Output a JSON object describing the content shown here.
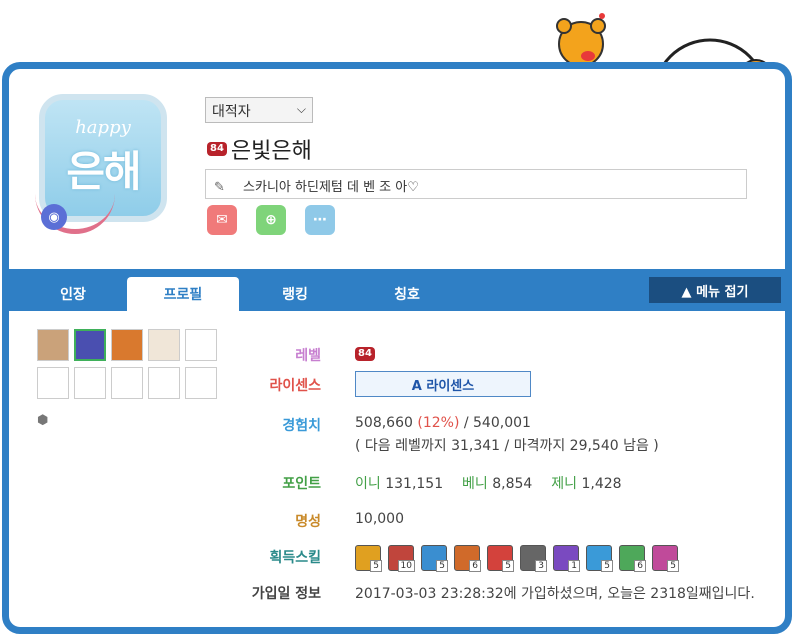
{
  "profile": {
    "job_select": "대적자",
    "level_badge": "84",
    "nickname": "은빛은해",
    "status_message": "스카니아 하딘제텀 데 벤 조 아♡",
    "avatar_text_top": "happy",
    "avatar_text_main": "은해"
  },
  "tabs": [
    {
      "label": "인장"
    },
    {
      "label": "프로필"
    },
    {
      "label": "랭킹"
    },
    {
      "label": "칭호"
    }
  ],
  "menu_fold_label": "▲ 메뉴 접기",
  "info": {
    "level_label": "레벨",
    "level_value": "84",
    "license_label": "라이센스",
    "license_button": "A  라이센스",
    "exp_label": "경험치",
    "exp_current": "508,660",
    "exp_percent": "(12%)",
    "exp_total": "/ 540,001",
    "exp_detail": "( 다음 레벨까지 31,341 / 마격까지 29,540 남음 )",
    "point_label": "포인트",
    "ini_label": "이니",
    "ini_value": "131,151",
    "beni_label": "베니",
    "beni_value": "8,854",
    "jeni_label": "제니",
    "jeni_value": "1,428",
    "fame_label": "명성",
    "fame_value": "10,000",
    "skill_label": "획득스킬",
    "join_label": "가입일 정보",
    "join_value": "2017-03-03 23:28:32에 가입하셨으며, 오늘은 2318일째입니다."
  },
  "skills": [
    {
      "level": "5",
      "color": "#e0a020"
    },
    {
      "level": "10",
      "color": "#c0453c"
    },
    {
      "level": "5",
      "color": "#3a8ed0"
    },
    {
      "level": "6",
      "color": "#d06a2a"
    },
    {
      "level": "5",
      "color": "#d3423c"
    },
    {
      "level": "3",
      "color": "#666666"
    },
    {
      "level": "1",
      "color": "#7a4ac0"
    },
    {
      "level": "5",
      "color": "#3a9ad8"
    },
    {
      "level": "6",
      "color": "#4ea85a"
    },
    {
      "level": "5",
      "color": "#c04a9a"
    }
  ],
  "colors": {
    "frame": "#2f7fc5",
    "level_label": "#c77fd0",
    "license_label": "#e0524a",
    "exp_label": "#3a9ad8",
    "point_label": "#43a047",
    "fame_label": "#c98a2a",
    "skill_label": "#2a8a8a",
    "join_label": "#444444"
  }
}
